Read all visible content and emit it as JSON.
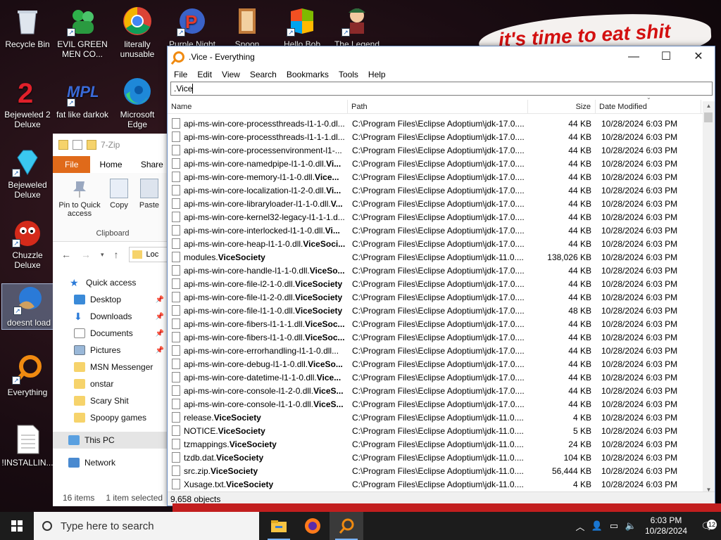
{
  "desktop": {
    "banner_text": "it's time to eat shit",
    "icons": [
      {
        "label": "Recycle Bin"
      },
      {
        "label": "EVIL GREEN MEN CO..."
      },
      {
        "label": "literally unusable"
      },
      {
        "label": "Purple Night"
      },
      {
        "label": "Spoon"
      },
      {
        "label": "Hello Bob"
      },
      {
        "label": "The Legend"
      },
      {
        "label": "Bejeweled 2 Deluxe"
      },
      {
        "label": "fat like darkok"
      },
      {
        "label": "Microsoft Edge"
      },
      {
        "label": "Bejeweled Deluxe"
      },
      {
        "label": "Chuzzle Deluxe"
      },
      {
        "label": "doesnt load"
      },
      {
        "label": "Everything"
      },
      {
        "label": "!INSTALLIN..."
      }
    ]
  },
  "explorer": {
    "title": "7-Zip",
    "tabs": [
      "File",
      "Home",
      "Share"
    ],
    "ribbon": {
      "pin_label": "Pin to Quick access",
      "copy_label": "Copy",
      "paste_label": "Paste",
      "group_label": "Clipboard"
    },
    "address": "Loc",
    "tree": [
      {
        "label": "Quick access"
      },
      {
        "label": "Desktop"
      },
      {
        "label": "Downloads"
      },
      {
        "label": "Documents"
      },
      {
        "label": "Pictures"
      },
      {
        "label": "MSN Messenger"
      },
      {
        "label": "onstar"
      },
      {
        "label": "Scary Shit"
      },
      {
        "label": "Spoopy games"
      },
      {
        "label": "This PC"
      },
      {
        "label": "Network"
      }
    ],
    "status": {
      "items": "16 items",
      "selected": "1 item selected"
    }
  },
  "everything": {
    "title": ".Vice - Everything",
    "menu": [
      "File",
      "Edit",
      "View",
      "Search",
      "Bookmarks",
      "Tools",
      "Help"
    ],
    "search_value": ".Vice",
    "columns": {
      "name": "Name",
      "path": "Path",
      "size": "Size",
      "date": "Date Modified"
    },
    "rows": [
      {
        "pre": "api-ms-win-core-processthreads-l1-1-0.dl...",
        "match": "",
        "post": "",
        "path": "C:\\Program Files\\Eclipse Adoptium\\jdk-17.0....",
        "size": "44 KB",
        "date": "10/28/2024 6:03 PM"
      },
      {
        "pre": "api-ms-win-core-processthreads-l1-1-1.dl...",
        "match": "",
        "post": "",
        "path": "C:\\Program Files\\Eclipse Adoptium\\jdk-17.0....",
        "size": "44 KB",
        "date": "10/28/2024 6:03 PM"
      },
      {
        "pre": "api-ms-win-core-processenvironment-l1-...",
        "match": "",
        "post": "",
        "path": "C:\\Program Files\\Eclipse Adoptium\\jdk-17.0....",
        "size": "44 KB",
        "date": "10/28/2024 6:03 PM"
      },
      {
        "pre": "api-ms-win-core-namedpipe-l1-1-0.dll.",
        "match": "Vi...",
        "post": "",
        "path": "C:\\Program Files\\Eclipse Adoptium\\jdk-17.0....",
        "size": "44 KB",
        "date": "10/28/2024 6:03 PM"
      },
      {
        "pre": "api-ms-win-core-memory-l1-1-0.dll.",
        "match": "Vice...",
        "post": "",
        "path": "C:\\Program Files\\Eclipse Adoptium\\jdk-17.0....",
        "size": "44 KB",
        "date": "10/28/2024 6:03 PM"
      },
      {
        "pre": "api-ms-win-core-localization-l1-2-0.dll.",
        "match": "Vi...",
        "post": "",
        "path": "C:\\Program Files\\Eclipse Adoptium\\jdk-17.0....",
        "size": "44 KB",
        "date": "10/28/2024 6:03 PM"
      },
      {
        "pre": "api-ms-win-core-libraryloader-l1-1-0.dll.",
        "match": "V...",
        "post": "",
        "path": "C:\\Program Files\\Eclipse Adoptium\\jdk-17.0....",
        "size": "44 KB",
        "date": "10/28/2024 6:03 PM"
      },
      {
        "pre": "api-ms-win-core-kernel32-legacy-l1-1-1.d...",
        "match": "",
        "post": "",
        "path": "C:\\Program Files\\Eclipse Adoptium\\jdk-17.0....",
        "size": "44 KB",
        "date": "10/28/2024 6:03 PM"
      },
      {
        "pre": "api-ms-win-core-interlocked-l1-1-0.dll.",
        "match": "Vi...",
        "post": "",
        "path": "C:\\Program Files\\Eclipse Adoptium\\jdk-17.0....",
        "size": "44 KB",
        "date": "10/28/2024 6:03 PM"
      },
      {
        "pre": "api-ms-win-core-heap-l1-1-0.dll.",
        "match": "ViceSoci...",
        "post": "",
        "path": "C:\\Program Files\\Eclipse Adoptium\\jdk-17.0....",
        "size": "44 KB",
        "date": "10/28/2024 6:03 PM"
      },
      {
        "pre": "modules.",
        "match": "ViceSociety",
        "post": "",
        "path": "C:\\Program Files\\Eclipse Adoptium\\jdk-11.0....",
        "size": "138,026 KB",
        "date": "10/28/2024 6:03 PM"
      },
      {
        "pre": "api-ms-win-core-handle-l1-1-0.dll.",
        "match": "ViceSo...",
        "post": "",
        "path": "C:\\Program Files\\Eclipse Adoptium\\jdk-17.0....",
        "size": "44 KB",
        "date": "10/28/2024 6:03 PM"
      },
      {
        "pre": "api-ms-win-core-file-l2-1-0.dll.",
        "match": "ViceSociety",
        "post": "",
        "path": "C:\\Program Files\\Eclipse Adoptium\\jdk-17.0....",
        "size": "44 KB",
        "date": "10/28/2024 6:03 PM"
      },
      {
        "pre": "api-ms-win-core-file-l1-2-0.dll.",
        "match": "ViceSociety",
        "post": "",
        "path": "C:\\Program Files\\Eclipse Adoptium\\jdk-17.0....",
        "size": "44 KB",
        "date": "10/28/2024 6:03 PM"
      },
      {
        "pre": "api-ms-win-core-file-l1-1-0.dll.",
        "match": "ViceSociety",
        "post": "",
        "path": "C:\\Program Files\\Eclipse Adoptium\\jdk-17.0....",
        "size": "48 KB",
        "date": "10/28/2024 6:03 PM"
      },
      {
        "pre": "api-ms-win-core-fibers-l1-1-1.dll.",
        "match": "ViceSoc...",
        "post": "",
        "path": "C:\\Program Files\\Eclipse Adoptium\\jdk-17.0....",
        "size": "44 KB",
        "date": "10/28/2024 6:03 PM"
      },
      {
        "pre": "api-ms-win-core-fibers-l1-1-0.dll.",
        "match": "ViceSoc...",
        "post": "",
        "path": "C:\\Program Files\\Eclipse Adoptium\\jdk-17.0....",
        "size": "44 KB",
        "date": "10/28/2024 6:03 PM"
      },
      {
        "pre": "api-ms-win-core-errorhandling-l1-1-0.dll...",
        "match": "",
        "post": "",
        "path": "C:\\Program Files\\Eclipse Adoptium\\jdk-17.0....",
        "size": "44 KB",
        "date": "10/28/2024 6:03 PM"
      },
      {
        "pre": "api-ms-win-core-debug-l1-1-0.dll.",
        "match": "ViceSo...",
        "post": "",
        "path": "C:\\Program Files\\Eclipse Adoptium\\jdk-17.0....",
        "size": "44 KB",
        "date": "10/28/2024 6:03 PM"
      },
      {
        "pre": "api-ms-win-core-datetime-l1-1-0.dll.",
        "match": "Vice...",
        "post": "",
        "path": "C:\\Program Files\\Eclipse Adoptium\\jdk-17.0....",
        "size": "44 KB",
        "date": "10/28/2024 6:03 PM"
      },
      {
        "pre": "api-ms-win-core-console-l1-2-0.dll.",
        "match": "ViceS...",
        "post": "",
        "path": "C:\\Program Files\\Eclipse Adoptium\\jdk-17.0....",
        "size": "44 KB",
        "date": "10/28/2024 6:03 PM"
      },
      {
        "pre": "api-ms-win-core-console-l1-1-0.dll.",
        "match": "ViceS...",
        "post": "",
        "path": "C:\\Program Files\\Eclipse Adoptium\\jdk-17.0....",
        "size": "44 KB",
        "date": "10/28/2024 6:03 PM"
      },
      {
        "pre": "release.",
        "match": "ViceSociety",
        "post": "",
        "path": "C:\\Program Files\\Eclipse Adoptium\\jdk-11.0....",
        "size": "4 KB",
        "date": "10/28/2024 6:03 PM"
      },
      {
        "pre": "NOTICE.",
        "match": "ViceSociety",
        "post": "",
        "path": "C:\\Program Files\\Eclipse Adoptium\\jdk-11.0....",
        "size": "5 KB",
        "date": "10/28/2024 6:03 PM"
      },
      {
        "pre": "tzmappings.",
        "match": "ViceSociety",
        "post": "",
        "path": "C:\\Program Files\\Eclipse Adoptium\\jdk-11.0....",
        "size": "24 KB",
        "date": "10/28/2024 6:03 PM"
      },
      {
        "pre": "tzdb.dat.",
        "match": "ViceSociety",
        "post": "",
        "path": "C:\\Program Files\\Eclipse Adoptium\\jdk-11.0....",
        "size": "104 KB",
        "date": "10/28/2024 6:03 PM"
      },
      {
        "pre": "src.zip.",
        "match": "ViceSociety",
        "post": "",
        "path": "C:\\Program Files\\Eclipse Adoptium\\jdk-11.0....",
        "size": "56,444 KB",
        "date": "10/28/2024 6:03 PM"
      },
      {
        "pre": "Xusage.txt.",
        "match": "ViceSociety",
        "post": "",
        "path": "C:\\Program Files\\Eclipse Adoptium\\jdk-11.0....",
        "size": "4 KB",
        "date": "10/28/2024 6:03 PM"
      }
    ],
    "status": "9,658 objects"
  },
  "taskbar": {
    "search_placeholder": "Type here to search",
    "time": "6:03 PM",
    "date": "10/28/2024",
    "notification_count": "12"
  },
  "colors": {
    "accent": "#0078d7",
    "explorer_file_tab": "#e06a1a",
    "everything_icon": "#f08a10"
  }
}
